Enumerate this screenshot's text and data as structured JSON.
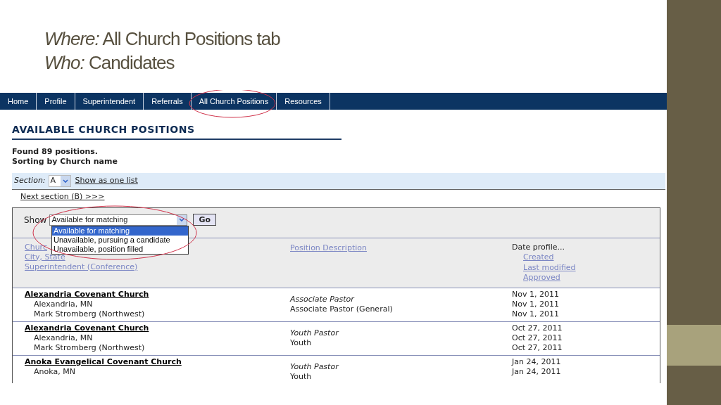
{
  "slide": {
    "lines": [
      "*Where:*  All Church Positions tab",
      "*Who:*  Candidates"
    ]
  },
  "nav": {
    "tabs": [
      {
        "label": "Home"
      },
      {
        "label": "Profile"
      },
      {
        "label": "Superintendent"
      },
      {
        "label": "Referrals"
      },
      {
        "label": "All Church Positions"
      },
      {
        "label": "Resources"
      }
    ]
  },
  "heading": "AVAILABLE CHURCH POSITIONS",
  "summary": [
    "Found 89 positions.",
    "Sorting by Church name"
  ],
  "section_bar": {
    "label": "Section:",
    "value": "A",
    "link": "Show as one list"
  },
  "next_link": "Next section (B) >>>",
  "filter": {
    "label": "Show",
    "value": "Available for matching",
    "button": "Go",
    "options": [
      {
        "label": "Available for matching",
        "selected": true
      },
      {
        "label": "Unavailable, pursuing a candidate",
        "selected": false
      },
      {
        "label": "Unavailable, position filled",
        "selected": false
      }
    ]
  },
  "columns": {
    "church": [
      "Churc",
      "City, State",
      "Superintendent (Conference)"
    ],
    "position": "Position Description",
    "dates_label": "Date profile...",
    "dates": [
      "Created",
      "Last modified",
      "Approved"
    ]
  },
  "rows": [
    {
      "church": "Alexandria Covenant Church",
      "city": "Alexandria, MN",
      "superintendent": "Mark Stromberg (Northwest)",
      "title": "Associate Pastor",
      "category": "Associate Pastor (General)",
      "dates": [
        "Nov 1, 2011",
        "Nov 1, 2011",
        "Nov 1, 2011"
      ]
    },
    {
      "church": "Alexandria Covenant Church",
      "city": "Alexandria, MN",
      "superintendent": "Mark Stromberg (Northwest)",
      "title": "Youth Pastor",
      "category": "Youth",
      "dates": [
        "Oct 27, 2011",
        "Oct 27, 2011",
        "Oct 27, 2011"
      ]
    },
    {
      "church": "Anoka Evangelical Covenant Church",
      "city": "Anoka, MN",
      "title": "Youth Pastor",
      "category": "Youth",
      "dates": [
        "Jan 24, 2011",
        "Jan 24, 2011"
      ]
    }
  ]
}
